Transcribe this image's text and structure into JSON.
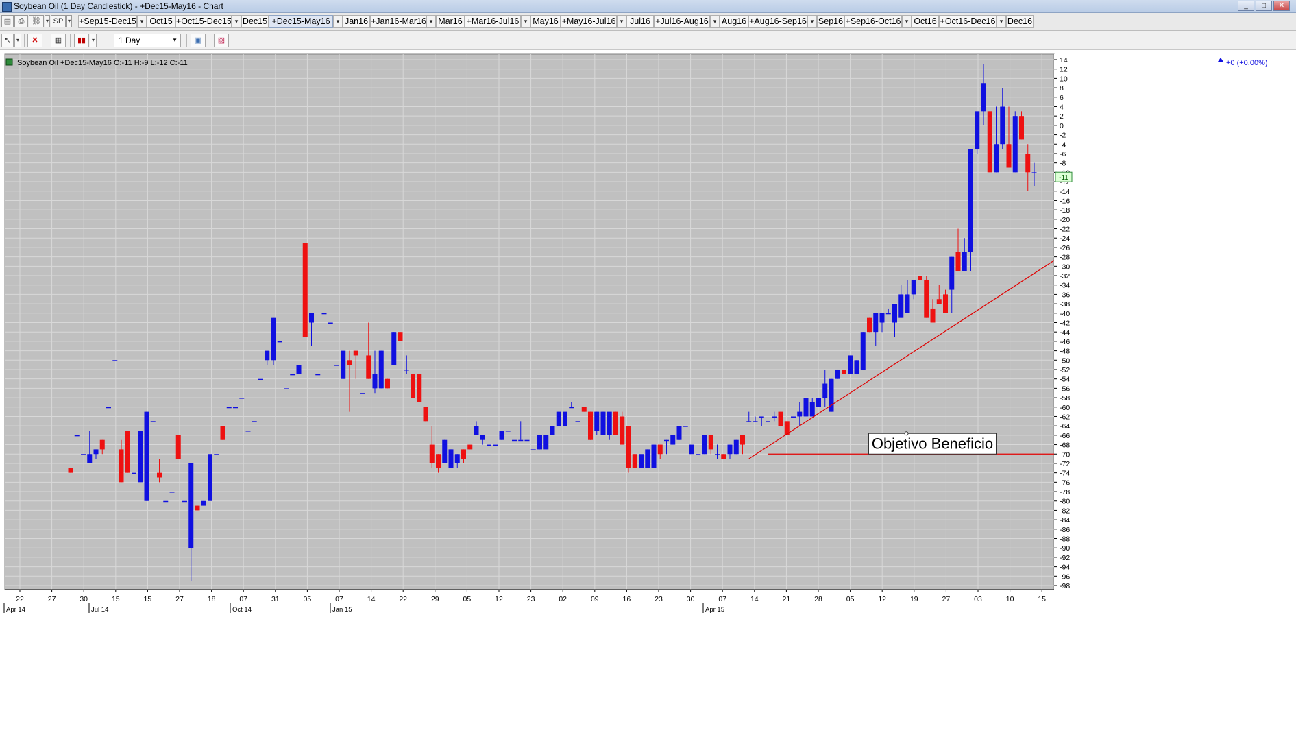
{
  "window": {
    "title": "Soybean Oil (1 Day Candlestick) - +Dec15-May16 - Chart",
    "buttons": [
      "_",
      "□",
      "✕"
    ]
  },
  "tabs_bar": {
    "symbol_button": "SP",
    "tabs": [
      {
        "label": "+Sep15-Dec15",
        "active": false
      },
      {
        "label": "Oct15",
        "active": false
      },
      {
        "label": "+Oct15-Dec15",
        "active": false
      },
      {
        "label": "Dec15",
        "active": false
      },
      {
        "label": "+Dec15-May16",
        "active": true
      },
      {
        "label": "Jan16",
        "active": false
      },
      {
        "label": "+Jan16-Mar16",
        "active": false
      },
      {
        "label": "Mar16",
        "active": false
      },
      {
        "label": "+Mar16-Jul16",
        "active": false
      },
      {
        "label": "May16",
        "active": false
      },
      {
        "label": "+May16-Jul16",
        "active": false
      },
      {
        "label": "Jul16",
        "active": false
      },
      {
        "label": "+Jul16-Aug16",
        "active": false
      },
      {
        "label": "Aug16",
        "active": false
      },
      {
        "label": "+Aug16-Sep16",
        "active": false
      },
      {
        "label": "Sep16",
        "active": false
      },
      {
        "label": "+Sep16-Oct16",
        "active": false
      },
      {
        "label": "Oct16",
        "active": false
      },
      {
        "label": "+Oct16-Dec16",
        "active": false
      },
      {
        "label": "Dec16",
        "active": false
      }
    ]
  },
  "toolbar": {
    "interval_value": "1 Day"
  },
  "chart_header": {
    "label": "Soybean Oil +Dec15-May16 O:-11 H:-9 L:-12 C:-11",
    "change": "+0 (+0.00%)"
  },
  "colors": {
    "up": "#1010e0",
    "down": "#ee1111",
    "background": "#c0c0c0",
    "grid": "#d8d8d8",
    "trendline": "#e00000"
  },
  "chart_data": {
    "type": "candlestick",
    "ylim": [
      -98,
      14
    ],
    "y_ticks": [
      14,
      12,
      10,
      8,
      6,
      4,
      2,
      0,
      -2,
      -4,
      -6,
      -8,
      -10,
      -12,
      -14,
      -16,
      -18,
      -20,
      -22,
      -24,
      -26,
      -28,
      -30,
      -32,
      -34,
      -36,
      -38,
      -40,
      -42,
      -44,
      -46,
      -48,
      -50,
      -52,
      -54,
      -56,
      -58,
      -60,
      -62,
      -64,
      -66,
      -68,
      -70,
      -72,
      -74,
      -76,
      -78,
      -80,
      -82,
      -84,
      -86,
      -88,
      -90,
      -92,
      -94,
      -96,
      -98
    ],
    "last_value_label": "-11",
    "x_tick_labels": [
      "22",
      "27",
      "30",
      "15",
      "15",
      "27",
      "18",
      "07",
      "31",
      "05",
      "07",
      "14",
      "22",
      "29",
      "05",
      "12",
      "23",
      "02",
      "09",
      "16",
      "23",
      "30",
      "07",
      "14",
      "21",
      "28",
      "05",
      "12",
      "19",
      "27",
      "03",
      "10",
      "15"
    ],
    "x_month_labels": [
      "Apr 14",
      "Jul 14",
      "Oct 14",
      "Jan 15",
      "Apr 15"
    ],
    "candles": [
      {
        "o": -73,
        "h": -73,
        "l": -74,
        "c": -74
      },
      {
        "o": -66,
        "h": -66,
        "l": -66,
        "c": -66
      },
      {
        "o": -70,
        "h": -70,
        "l": -70,
        "c": -70
      },
      {
        "o": -72,
        "h": -65,
        "l": -72,
        "c": -70
      },
      {
        "o": -70,
        "h": -69,
        "l": -71,
        "c": -69
      },
      {
        "o": -67,
        "h": -67,
        "l": -70,
        "c": -69
      },
      {
        "o": -60,
        "h": -60,
        "l": -60,
        "c": -60
      },
      {
        "o": -50,
        "h": -50,
        "l": -50,
        "c": -50
      },
      {
        "o": -69,
        "h": -67,
        "l": -76,
        "c": -76
      },
      {
        "o": -65,
        "h": -65,
        "l": -74,
        "c": -74
      },
      {
        "o": -74,
        "h": -74,
        "l": -74,
        "c": -74
      },
      {
        "o": -76,
        "h": -65,
        "l": -76,
        "c": -65
      },
      {
        "o": -80,
        "h": -61,
        "l": -80,
        "c": -61
      },
      {
        "o": -63,
        "h": -63,
        "l": -63,
        "c": -63
      },
      {
        "o": -74,
        "h": -71,
        "l": -76,
        "c": -75
      },
      {
        "o": -80,
        "h": -80,
        "l": -80,
        "c": -80
      },
      {
        "o": -78,
        "h": -78,
        "l": -78,
        "c": -78
      },
      {
        "o": -66,
        "h": -66,
        "l": -71,
        "c": -71
      },
      {
        "o": -80,
        "h": -80,
        "l": -80,
        "c": -80
      },
      {
        "o": -90,
        "h": -72,
        "l": -97,
        "c": -72
      },
      {
        "o": -81,
        "h": -81,
        "l": -82,
        "c": -82
      },
      {
        "o": -81,
        "h": -80,
        "l": -81,
        "c": -80
      },
      {
        "o": -80,
        "h": -70,
        "l": -80,
        "c": -70
      },
      {
        "o": -70,
        "h": -70,
        "l": -70,
        "c": -70
      },
      {
        "o": -64,
        "h": -64,
        "l": -67,
        "c": -67
      },
      {
        "o": -60,
        "h": -60,
        "l": -60,
        "c": -60
      },
      {
        "o": -60,
        "h": -60,
        "l": -60,
        "c": -60
      },
      {
        "o": -58,
        "h": -58,
        "l": -58,
        "c": -58
      },
      {
        "o": -65,
        "h": -65,
        "l": -65,
        "c": -65
      },
      {
        "o": -63,
        "h": -63,
        "l": -63,
        "c": -63
      },
      {
        "o": -54,
        "h": -54,
        "l": -54,
        "c": -54
      },
      {
        "o": -50,
        "h": -48,
        "l": -51,
        "c": -48
      },
      {
        "o": -50,
        "h": -41,
        "l": -51,
        "c": -41
      },
      {
        "o": -46,
        "h": -46,
        "l": -46,
        "c": -46
      },
      {
        "o": -56,
        "h": -56,
        "l": -56,
        "c": -56
      },
      {
        "o": -53,
        "h": -53,
        "l": -53,
        "c": -53
      },
      {
        "o": -53,
        "h": -51,
        "l": -53,
        "c": -51
      },
      {
        "o": -25,
        "h": -25,
        "l": -45,
        "c": -45
      },
      {
        "o": -42,
        "h": -40,
        "l": -47,
        "c": -40
      },
      {
        "o": -53,
        "h": -53,
        "l": -53,
        "c": -53
      },
      {
        "o": -40,
        "h": -40,
        "l": -40,
        "c": -40
      },
      {
        "o": -42,
        "h": -42,
        "l": -42,
        "c": -42
      },
      {
        "o": -51,
        "h": -51,
        "l": -51,
        "c": -51
      },
      {
        "o": -54,
        "h": -48,
        "l": -54,
        "c": -48
      },
      {
        "o": -50,
        "h": -48,
        "l": -61,
        "c": -51
      },
      {
        "o": -48,
        "h": -48,
        "l": -54,
        "c": -49
      },
      {
        "o": -57,
        "h": -57,
        "l": -57,
        "c": -57
      },
      {
        "o": -49,
        "h": -42,
        "l": -54,
        "c": -54
      },
      {
        "o": -56,
        "h": -48,
        "l": -57,
        "c": -53
      },
      {
        "o": -56,
        "h": -48,
        "l": -56,
        "c": -48
      },
      {
        "o": -54,
        "h": -54,
        "l": -56,
        "c": -56
      },
      {
        "o": -51,
        "h": -44,
        "l": -51,
        "c": -44
      },
      {
        "o": -44,
        "h": -44,
        "l": -46,
        "c": -46
      },
      {
        "o": -52,
        "h": -49,
        "l": -53,
        "c": -52
      },
      {
        "o": -53,
        "h": -53,
        "l": -58,
        "c": -58
      },
      {
        "o": -53,
        "h": -53,
        "l": -59,
        "c": -59
      },
      {
        "o": -60,
        "h": -60,
        "l": -63,
        "c": -63
      },
      {
        "o": -68,
        "h": -64,
        "l": -73,
        "c": -72
      },
      {
        "o": -70,
        "h": -70,
        "l": -74,
        "c": -73
      },
      {
        "o": -72,
        "h": -67,
        "l": -72,
        "c": -67
      },
      {
        "o": -73,
        "h": -69,
        "l": -73,
        "c": -69
      },
      {
        "o": -72,
        "h": -70,
        "l": -73,
        "c": -70
      },
      {
        "o": -69,
        "h": -69,
        "l": -72,
        "c": -71
      },
      {
        "o": -68,
        "h": -68,
        "l": -69,
        "c": -69
      },
      {
        "o": -66,
        "h": -63,
        "l": -66,
        "c": -64
      },
      {
        "o": -67,
        "h": -66,
        "l": -68,
        "c": -66
      },
      {
        "o": -68,
        "h": -67,
        "l": -69,
        "c": -68
      },
      {
        "o": -68,
        "h": -68,
        "l": -68,
        "c": -68
      },
      {
        "o": -67,
        "h": -65,
        "l": -67,
        "c": -65
      },
      {
        "o": -65,
        "h": -65,
        "l": -65,
        "c": -65
      },
      {
        "o": -67,
        "h": -67,
        "l": -67,
        "c": -67
      },
      {
        "o": -67,
        "h": -63,
        "l": -67,
        "c": -67
      },
      {
        "o": -67,
        "h": -67,
        "l": -67,
        "c": -67
      },
      {
        "o": -69,
        "h": -69,
        "l": -69,
        "c": -69
      },
      {
        "o": -69,
        "h": -66,
        "l": -69,
        "c": -66
      },
      {
        "o": -69,
        "h": -66,
        "l": -69,
        "c": -66
      },
      {
        "o": -66,
        "h": -64,
        "l": -66,
        "c": -64
      },
      {
        "o": -64,
        "h": -61,
        "l": -64,
        "c": -61
      },
      {
        "o": -64,
        "h": -61,
        "l": -66,
        "c": -61
      },
      {
        "o": -60,
        "h": -59,
        "l": -60,
        "c": -60
      },
      {
        "o": -63,
        "h": -63,
        "l": -63,
        "c": -63
      },
      {
        "o": -60,
        "h": -60,
        "l": -61,
        "c": -61
      },
      {
        "o": -61,
        "h": -61,
        "l": -67,
        "c": -67
      },
      {
        "o": -65,
        "h": -61,
        "l": -66,
        "c": -61
      },
      {
        "o": -66,
        "h": -61,
        "l": -66,
        "c": -61
      },
      {
        "o": -66,
        "h": -63,
        "l": -67,
        "c": -61
      },
      {
        "o": -61,
        "h": -61,
        "l": -66,
        "c": -66
      },
      {
        "o": -62,
        "h": -61,
        "l": -68,
        "c": -68
      },
      {
        "o": -64,
        "h": -64,
        "l": -74,
        "c": -73
      },
      {
        "o": -70,
        "h": -70,
        "l": -73,
        "c": -73
      },
      {
        "o": -73,
        "h": -70,
        "l": -74,
        "c": -70
      },
      {
        "o": -73,
        "h": -69,
        "l": -73,
        "c": -69
      },
      {
        "o": -73,
        "h": -68,
        "l": -73,
        "c": -68
      },
      {
        "o": -68,
        "h": -68,
        "l": -71,
        "c": -70
      },
      {
        "o": -67,
        "h": -67,
        "l": -70,
        "c": -67
      },
      {
        "o": -68,
        "h": -66,
        "l": -68,
        "c": -66
      },
      {
        "o": -67,
        "h": -64,
        "l": -67,
        "c": -64
      },
      {
        "o": -64,
        "h": -64,
        "l": -64,
        "c": -64
      },
      {
        "o": -70,
        "h": -68,
        "l": -71,
        "c": -68
      },
      {
        "o": -70,
        "h": -70,
        "l": -70,
        "c": -70
      },
      {
        "o": -70,
        "h": -68,
        "l": -70,
        "c": -66
      },
      {
        "o": -66,
        "h": -66,
        "l": -70,
        "c": -69
      },
      {
        "o": -70,
        "h": -68,
        "l": -71,
        "c": -70
      },
      {
        "o": -70,
        "h": -70,
        "l": -71,
        "c": -71
      },
      {
        "o": -70,
        "h": -68,
        "l": -71,
        "c": -68
      },
      {
        "o": -70,
        "h": -67,
        "l": -70,
        "c": -67
      },
      {
        "o": -66,
        "h": -66,
        "l": -70,
        "c": -68
      },
      {
        "o": -63,
        "h": -61,
        "l": -63,
        "c": -63
      },
      {
        "o": -63,
        "h": -62,
        "l": -63,
        "c": -63
      },
      {
        "o": -62,
        "h": -62,
        "l": -64,
        "c": -62
      },
      {
        "o": -63,
        "h": -63,
        "l": -63,
        "c": -63
      },
      {
        "o": -62,
        "h": -61,
        "l": -63,
        "c": -62
      },
      {
        "o": -61,
        "h": -61,
        "l": -64,
        "c": -64
      },
      {
        "o": -63,
        "h": -63,
        "l": -66,
        "c": -66
      },
      {
        "o": -62,
        "h": -62,
        "l": -62,
        "c": -62
      },
      {
        "o": -62,
        "h": -59,
        "l": -64,
        "c": -61
      },
      {
        "o": -62,
        "h": -58,
        "l": -62,
        "c": -58
      },
      {
        "o": -62,
        "h": -58,
        "l": -62,
        "c": -59
      },
      {
        "o": -60,
        "h": -58,
        "l": -60,
        "c": -58
      },
      {
        "o": -58,
        "h": -52,
        "l": -60,
        "c": -55
      },
      {
        "o": -61,
        "h": -54,
        "l": -61,
        "c": -54
      },
      {
        "o": -54,
        "h": -52,
        "l": -54,
        "c": -52
      },
      {
        "o": -52,
        "h": -52,
        "l": -53,
        "c": -53
      },
      {
        "o": -53,
        "h": -49,
        "l": -53,
        "c": -49
      },
      {
        "o": -53,
        "h": -50,
        "l": -53,
        "c": -50
      },
      {
        "o": -52,
        "h": -44,
        "l": -52,
        "c": -44
      },
      {
        "o": -41,
        "h": -41,
        "l": -44,
        "c": -44
      },
      {
        "o": -44,
        "h": -40,
        "l": -47,
        "c": -40
      },
      {
        "o": -42,
        "h": -40,
        "l": -44,
        "c": -40
      },
      {
        "o": -40,
        "h": -39,
        "l": -40,
        "c": -40
      },
      {
        "o": -42,
        "h": -38,
        "l": -45,
        "c": -38
      },
      {
        "o": -41,
        "h": -34,
        "l": -41,
        "c": -36
      },
      {
        "o": -40,
        "h": -33,
        "l": -40,
        "c": -36
      },
      {
        "o": -36,
        "h": -33,
        "l": -37,
        "c": -33
      },
      {
        "o": -32,
        "h": -31,
        "l": -33,
        "c": -33
      },
      {
        "o": -33,
        "h": -32,
        "l": -41,
        "c": -41
      },
      {
        "o": -39,
        "h": -37,
        "l": -42,
        "c": -42
      },
      {
        "o": -37,
        "h": -34,
        "l": -38,
        "c": -38
      },
      {
        "o": -36,
        "h": -35,
        "l": -40,
        "c": -40
      },
      {
        "o": -35,
        "h": -28,
        "l": -40,
        "c": -28
      },
      {
        "o": -27,
        "h": -22,
        "l": -31,
        "c": -31
      },
      {
        "o": -31,
        "h": -24,
        "l": -31,
        "c": -27
      },
      {
        "o": -27,
        "h": -5,
        "l": -31,
        "c": -5
      },
      {
        "o": -5,
        "h": -3,
        "l": -6,
        "c": 3
      },
      {
        "o": 3,
        "h": 13,
        "l": 0,
        "c": 9
      },
      {
        "o": 3,
        "h": 3,
        "l": -10,
        "c": -10
      },
      {
        "o": -10,
        "h": 4,
        "l": -10,
        "c": -4
      },
      {
        "o": -4,
        "h": 8,
        "l": -5,
        "c": 4
      },
      {
        "o": -4,
        "h": 4,
        "l": -9,
        "c": -9
      },
      {
        "o": -10,
        "h": 3,
        "l": -10,
        "c": 2
      },
      {
        "o": 2,
        "h": 3,
        "l": -3,
        "c": -3
      },
      {
        "o": -6,
        "h": -4,
        "l": -14,
        "c": -10
      },
      {
        "o": -10,
        "h": -8,
        "l": -13,
        "c": -10
      }
    ],
    "trendline": {
      "from": {
        "i": 107,
        "y": -71
      },
      "to": {
        "i": 164,
        "y": -21
      }
    },
    "target_line": {
      "from_i": 110,
      "to_i": 164,
      "y": -70
    },
    "annotation": "Objetivo Beneficio"
  }
}
